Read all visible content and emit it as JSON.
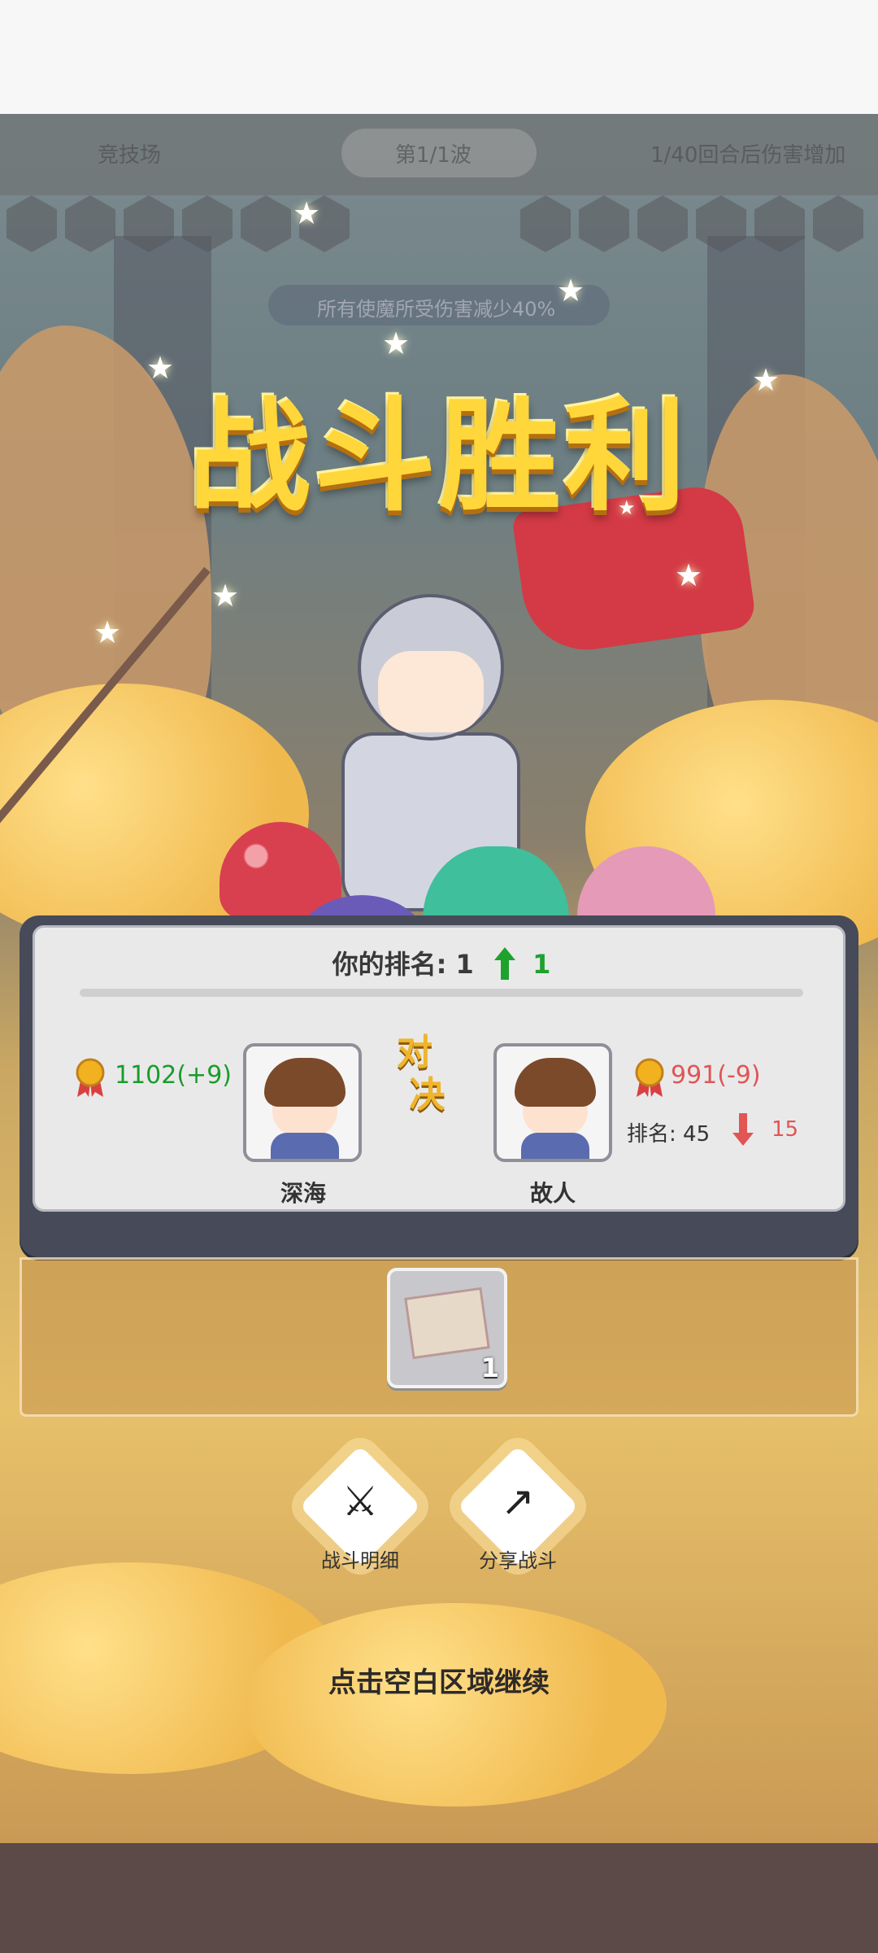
{
  "top_bar": {
    "left_label": "竞技场",
    "stage_label": "第1/1波",
    "right_label": "1/40回合后伤害增加"
  },
  "buff_text": "所有使魔所受伤害减少40%",
  "result_title": "战斗胜利",
  "ranking": {
    "label": "你的排名: 1",
    "change": "1",
    "vs_label": "对\n决"
  },
  "player": {
    "name": "深海",
    "score": "1102(+9)"
  },
  "opponent": {
    "name": "故人",
    "score": "991(-9)",
    "rank_label": "排名: 45",
    "rank_drop": "15"
  },
  "reward": {
    "item_icon": "treasure-map-icon",
    "quantity": "1"
  },
  "actions": {
    "detail_label": "战斗明细",
    "share_label": "分享战斗"
  },
  "continue_hint": "点击空白区域继续",
  "colors": {
    "gain": "#1a9c2b",
    "loss": "#e15555",
    "title_gold": "#ffd73a",
    "card_frame": "#474a58"
  }
}
